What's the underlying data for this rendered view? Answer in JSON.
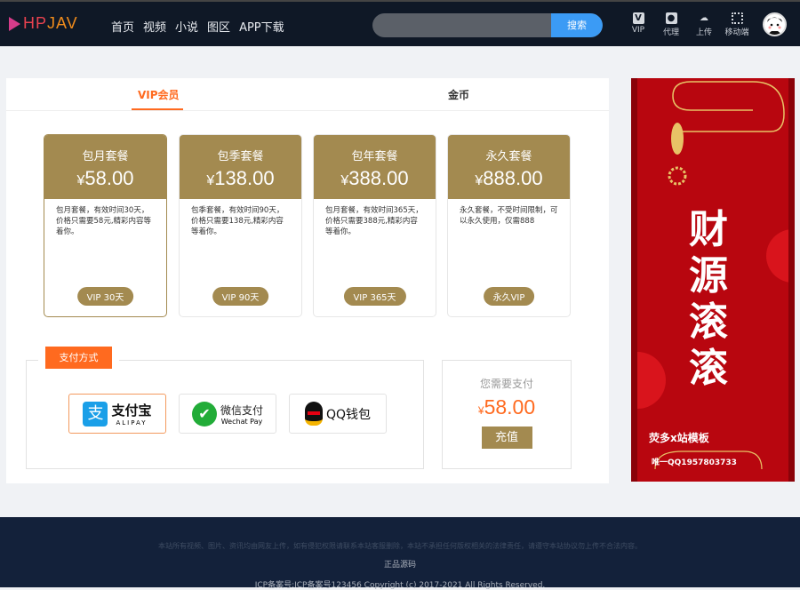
{
  "header": {
    "logo_a": "HP",
    "logo_b": "JAV",
    "nav": [
      "首页",
      "视频",
      "小说",
      "图区",
      "APP下载"
    ],
    "search_placeholder": "",
    "search_button": "搜索",
    "icons": [
      {
        "label": "VIP",
        "icon": "vip-icon"
      },
      {
        "label": "代理",
        "icon": "agent-icon"
      },
      {
        "label": "上传",
        "icon": "upload-icon"
      },
      {
        "label": "移动端",
        "icon": "qrcode-icon"
      }
    ]
  },
  "tabs": [
    "VIP会员",
    "金币"
  ],
  "plans": [
    {
      "name": "包月套餐",
      "currency": "¥",
      "price": "58.00",
      "desc": "包月套餐，有效时间30天，价格只需要58元,精彩内容等着你。",
      "badge": "VIP 30天"
    },
    {
      "name": "包季套餐",
      "currency": "¥",
      "price": "138.00",
      "desc": "包季套餐，有效时间90天，价格只需要138元,精彩内容等着你。",
      "badge": "VIP 90天"
    },
    {
      "name": "包年套餐",
      "currency": "¥",
      "price": "388.00",
      "desc": "包月套餐，有效时间365天，价格只需要388元,精彩内容等着你。",
      "badge": "VIP 365天"
    },
    {
      "name": "永久套餐",
      "currency": "¥",
      "price": "888.00",
      "desc": "永久套餐，不受时间限制，可以永久使用，仅需888",
      "badge": "永久VIP"
    }
  ],
  "payment": {
    "label": "支付方式",
    "methods": [
      {
        "name": "支付宝",
        "sub": "ALIPAY"
      },
      {
        "name": "微信支付",
        "sub": "Wechat Pay"
      },
      {
        "name": "QQ钱包",
        "sub": ""
      }
    ],
    "need_label": "您需要支付",
    "currency": "¥",
    "amount": "58.00",
    "submit": "充值"
  },
  "banner": {
    "title": "财源滚滚",
    "line1": "荧多x站模板",
    "line2": "唯一QQ1957803733"
  },
  "footer": {
    "disclaimer": "本站所有视频、图片、资讯均由网友上传，如有侵犯权限请联系本站客服删除，本站不承担任何版权相关的法律责任，请遵守本站协议勿上传不合法内容。",
    "link": "正品源码",
    "copyright": "ICP备案号:ICP备案号123456   Copyright (c) 2017-2021 All Rights Reserved."
  },
  "colors": {
    "gold": "#a38a50",
    "accent": "#ff6a1f",
    "header": "#0f1826",
    "search": "#3b9bf5"
  }
}
